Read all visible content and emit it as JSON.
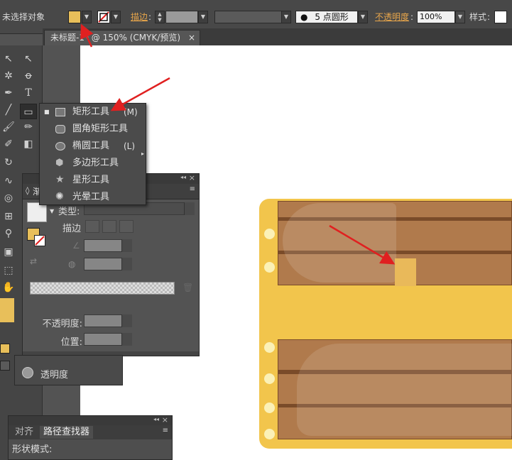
{
  "control_bar": {
    "selection_status": "未选择对象",
    "stroke_label": "描边",
    "brush_size": "5",
    "brush_shape": "点圆形",
    "opacity_label": "不透明度",
    "opacity_value": "100%",
    "style_label": "样式"
  },
  "document": {
    "tab_title": "未标题-1* @ 150% (CMYK/预览)",
    "close_glyph": "×"
  },
  "tool_flyout": {
    "items": [
      {
        "label": "矩形工具",
        "shortcut": "(M)",
        "icon": "rectangle-icon"
      },
      {
        "label": "圆角矩形工具",
        "shortcut": "",
        "icon": "rounded-rectangle-icon"
      },
      {
        "label": "椭圆工具",
        "shortcut": "(L)",
        "icon": "ellipse-icon"
      },
      {
        "label": "多边形工具",
        "shortcut": "",
        "icon": "polygon-icon"
      },
      {
        "label": "星形工具",
        "shortcut": "",
        "icon": "star-icon"
      },
      {
        "label": "光晕工具",
        "shortcut": "",
        "icon": "flare-icon"
      }
    ]
  },
  "gradient_panel": {
    "tab_label": "渐",
    "type_label": "类型:",
    "stroke_label": "描边",
    "opacity_label": "不透明度:",
    "position_label": "位置:"
  },
  "transparency_panel": {
    "label": "透明度"
  },
  "pathfinder_panel": {
    "tabs": [
      "对齐",
      "路径查找器"
    ],
    "shape_modes_label": "形状模式:"
  },
  "colors": {
    "fill_swatch": "#e8bf5a",
    "chest_body": "#f2c54c",
    "wood": "#b07a4c",
    "wood_dark": "#7a4b29",
    "latch": "#e9b95a",
    "arrow": "#e02020"
  }
}
